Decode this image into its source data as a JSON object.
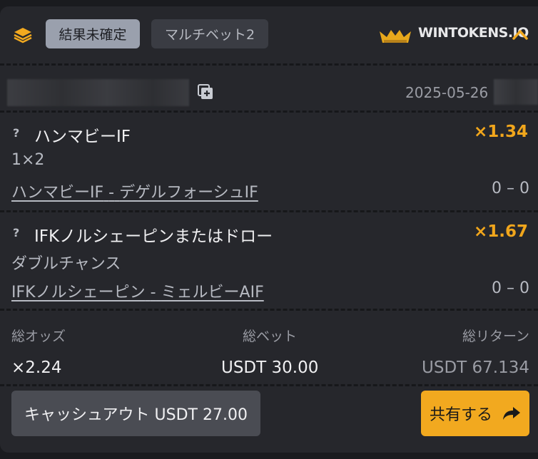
{
  "header": {
    "status": "結果未確定",
    "bet_type": "マルチベット2",
    "brand": "WINTOKENS.IO",
    "accent": "#f2a91f"
  },
  "ticket": {
    "date": "2025-05-26"
  },
  "bets": [
    {
      "selection": "ハンマビーIF",
      "odds": "×1.34",
      "market": "1×2",
      "home": "ハンマビーIF",
      "sep": "-",
      "away": "デゲルフォーシュIF",
      "score": "0 – 0"
    },
    {
      "selection": "IFKノルシェーピンまたはドロー",
      "odds": "×1.67",
      "market": "ダブルチャンス",
      "home": "IFKノルシェーピン",
      "sep": "-",
      "away": "ミェルビーAIF",
      "score": "0 – 0"
    }
  ],
  "summary": {
    "total_odds_label": "総オッズ",
    "total_bet_label": "総ベット",
    "total_return_label": "総リターン",
    "total_odds": "×2.24",
    "total_bet": "USDT 30.00",
    "total_return": "USDT 67.134"
  },
  "actions": {
    "cashout": "キャッシュアウト USDT 27.00",
    "share": "共有する"
  },
  "icons": [
    "stack-icon",
    "crown-icon",
    "chevron-up-icon",
    "copy-icon",
    "question-icon",
    "share-arrow-icon"
  ]
}
